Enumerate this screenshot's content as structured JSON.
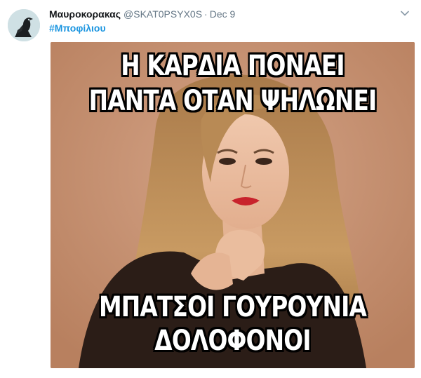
{
  "tweet": {
    "display_name": "Μαυροκορακας",
    "handle": "@SKAT0PSYX0S",
    "separator": "·",
    "date": "Dec 9",
    "hashtag": "#Μποφίλιου"
  },
  "meme": {
    "top_line_1": "Η ΚΑΡΔΙΑ ΠΟΝΑΕΙ",
    "top_line_2": "ΠΑΝΤΑ ΟΤΑΝ ΨΗΛΩΝΕΙ",
    "bottom_line_1": "ΜΠΑΤΣΟΙ ΓΟΥΡΟΥΝΙΑ",
    "bottom_line_2": "ΔΟΛΟΦΟΝΟΙ"
  },
  "icons": {
    "avatar": "crow-avatar-icon",
    "menu": "chevron-down-icon"
  },
  "colors": {
    "hashtag": "#1b95e0",
    "secondary_text": "#657786",
    "media_background": "#c99679"
  }
}
